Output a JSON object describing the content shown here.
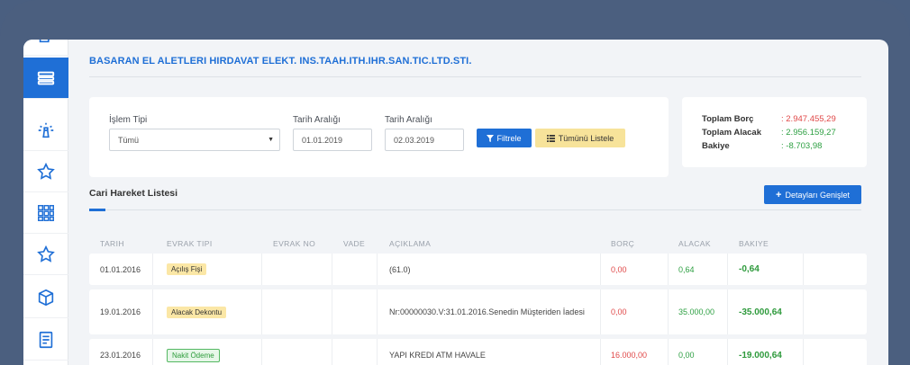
{
  "company": "BASARAN EL ALETLERI HIRDAVAT ELEKT. INS.TAAH.ITH.IHR.SAN.TIC.LTD.STI.",
  "filters": {
    "islem_tipi_label": "İşlem Tipi",
    "islem_tipi_value": "Tümü",
    "tarih1_label": "Tarih Aralığı",
    "tarih1_value": "01.01.2019",
    "tarih2_label": "Tarih Aralığı",
    "tarih2_value": "02.03.2019",
    "filter_button": "Filtrele",
    "list_all_button": "Tümünü Listele"
  },
  "summary": {
    "borc_label": "Toplam Borç",
    "borc_value": ": 2.947.455,29",
    "alacak_label": "Toplam Alacak",
    "alacak_value": ": 2.956.159,27",
    "bakiye_label": "Bakiye",
    "bakiye_value": ": -8.703,98",
    "colors": {
      "borc": "#e04848",
      "alacak": "#2ea043",
      "bakiye": "#2ea043"
    }
  },
  "list": {
    "title": "Cari Hareket Listesi",
    "expand_button": "Detayları Genişlet",
    "headers": [
      "TARIH",
      "EVRAK TIPI",
      "EVRAK NO",
      "VADE",
      "AÇIKLAMA",
      "BORÇ",
      "ALACAK",
      "BAKIYE"
    ],
    "rows": [
      {
        "tarih": "01.01.2016",
        "evrak_tipi": "Açılış Fişi",
        "badge": "yellow",
        "evrak_no": "",
        "vade": "",
        "aciklama": "(61.0)",
        "borc": "0,00",
        "alacak": "0,64",
        "bakiye": "-0,64"
      },
      {
        "tarih": "19.01.2016",
        "evrak_tipi": "Alacak Dekontu",
        "badge": "yellow",
        "evrak_no": "",
        "vade": "",
        "aciklama": "Nr:00000030.V:31.01.2016.Senedin Müşteriden İadesi",
        "borc": "0,00",
        "alacak": "35.000,00",
        "bakiye": "-35.000,64"
      },
      {
        "tarih": "23.01.2016",
        "evrak_tipi": "Nakit Ödeme",
        "badge": "green",
        "evrak_no": "",
        "vade": "",
        "aciklama": "YAPI KREDI ATM HAVALE",
        "borc": "16.000,00",
        "alacak": "0,00",
        "bakiye": "-19.000,64"
      }
    ]
  },
  "sidebar_icons": [
    "checklist-icon",
    "list-icon",
    "lighthouse-icon",
    "star-icon",
    "grid-icon",
    "star-icon",
    "box-icon",
    "document-icon"
  ]
}
